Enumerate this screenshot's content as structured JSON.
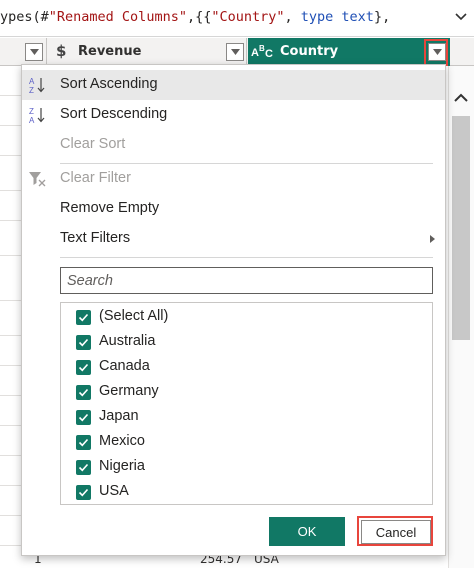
{
  "formula_bar": {
    "prefix": "ypes(#",
    "string1": "\"Renamed Columns\"",
    "mid": ",{{",
    "string2": "\"Country\"",
    "comma": ", ",
    "keyword": "type",
    "space": " ",
    "keyword2": "text",
    "suffix": "},"
  },
  "grid_header": {
    "revenue_type_icon": "$",
    "revenue_label": "Revenue",
    "country_type_icon": "ABC",
    "country_label": "Country"
  },
  "bottom_row": {
    "row_number": "1",
    "value": "254.57",
    "country": "USA"
  },
  "menu": {
    "items": [
      {
        "label": "Sort Ascending",
        "icon": "sort-ascending-icon",
        "enabled": true,
        "active": true
      },
      {
        "label": "Sort Descending",
        "icon": "sort-descending-icon",
        "enabled": true
      },
      {
        "label": "Clear Sort",
        "enabled": false
      },
      {
        "label": "Clear Filter",
        "icon": "clear-filter-icon",
        "enabled": false
      },
      {
        "label": "Remove Empty",
        "enabled": true
      },
      {
        "label": "Text Filters",
        "enabled": true,
        "submenu": true
      }
    ],
    "search_placeholder": "Search",
    "values": [
      {
        "label": "(Select All)",
        "checked": true
      },
      {
        "label": "Australia",
        "checked": true
      },
      {
        "label": "Canada",
        "checked": true
      },
      {
        "label": "Germany",
        "checked": true
      },
      {
        "label": "Japan",
        "checked": true
      },
      {
        "label": "Mexico",
        "checked": true
      },
      {
        "label": "Nigeria",
        "checked": true
      },
      {
        "label": "USA",
        "checked": true
      }
    ],
    "ok_label": "OK",
    "cancel_label": "Cancel"
  },
  "colors": {
    "accent": "#117865",
    "highlight": "#e8453c"
  }
}
